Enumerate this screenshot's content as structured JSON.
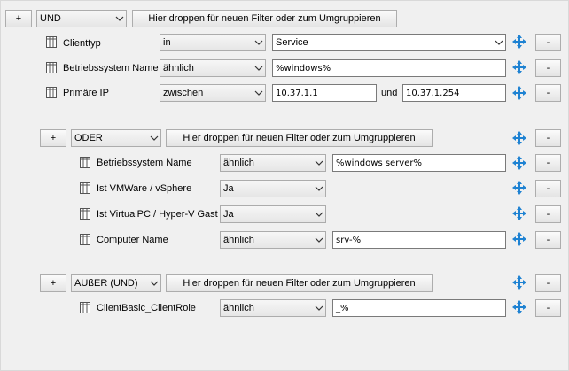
{
  "root": {
    "add_label": "+",
    "operator": "UND",
    "drop_label": "Hier droppen für neuen Filter oder zum Umgruppieren",
    "rows": [
      {
        "field": "Clienttyp",
        "op": "in",
        "value": "Service",
        "remove_label": "-"
      },
      {
        "field": "Betriebssystem Name",
        "op": "ähnlich",
        "value": "%windows%",
        "remove_label": "-"
      },
      {
        "field": "Primäre IP",
        "op": "zwischen",
        "value": "10.37.1.1",
        "and_label": "und",
        "value2": "10.37.1.254",
        "remove_label": "-"
      }
    ]
  },
  "group_oder": {
    "add_label": "+",
    "operator": "ODER",
    "drop_label": "Hier droppen für neuen Filter oder zum Umgruppieren",
    "remove_label": "-",
    "rows": [
      {
        "field": "Betriebssystem Name",
        "op": "ähnlich",
        "value": "%windows server%",
        "remove_label": "-"
      },
      {
        "field": "Ist VMWare / vSphere",
        "op": "Ja",
        "remove_label": "-"
      },
      {
        "field": "Ist VirtualPC / Hyper-V Gast",
        "op": "Ja",
        "remove_label": "-"
      },
      {
        "field": "Computer Name",
        "op": "ähnlich",
        "value": "srv-%",
        "remove_label": "-"
      }
    ]
  },
  "group_ausser": {
    "add_label": "+",
    "operator": "AUßER (UND)",
    "drop_label": "Hier droppen für neuen Filter oder zum Umgruppieren",
    "remove_label": "-",
    "rows": [
      {
        "field": "ClientBasic_ClientRole",
        "op": "ähnlich",
        "value": "_%",
        "remove_label": "-"
      }
    ]
  },
  "icons": {
    "table": "table-icon",
    "move": "move-arrows-icon",
    "chevron": "chevron-down-icon"
  },
  "colors": {
    "move_icon": "#1e82d2",
    "background": "#f0f0f0"
  }
}
